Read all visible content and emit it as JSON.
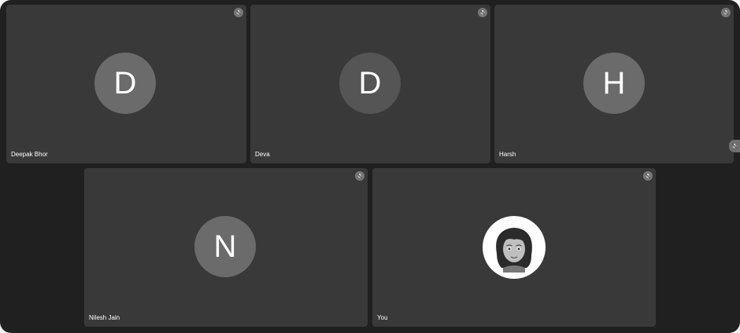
{
  "participants": [
    {
      "name": "Deepak Bhor",
      "initial": "D"
    },
    {
      "name": "Deva",
      "initial": "D"
    },
    {
      "name": "Harsh",
      "initial": "H"
    },
    {
      "name": "Nilesh Jain",
      "initial": "N"
    },
    {
      "name": "You",
      "initial": ""
    }
  ],
  "icons": {
    "mic": "mic-off-icon",
    "self_avatar": "memoji-avatar-icon"
  },
  "colors": {
    "background": "#202020",
    "tile": "#393939",
    "avatar": "#6b6b6b"
  }
}
